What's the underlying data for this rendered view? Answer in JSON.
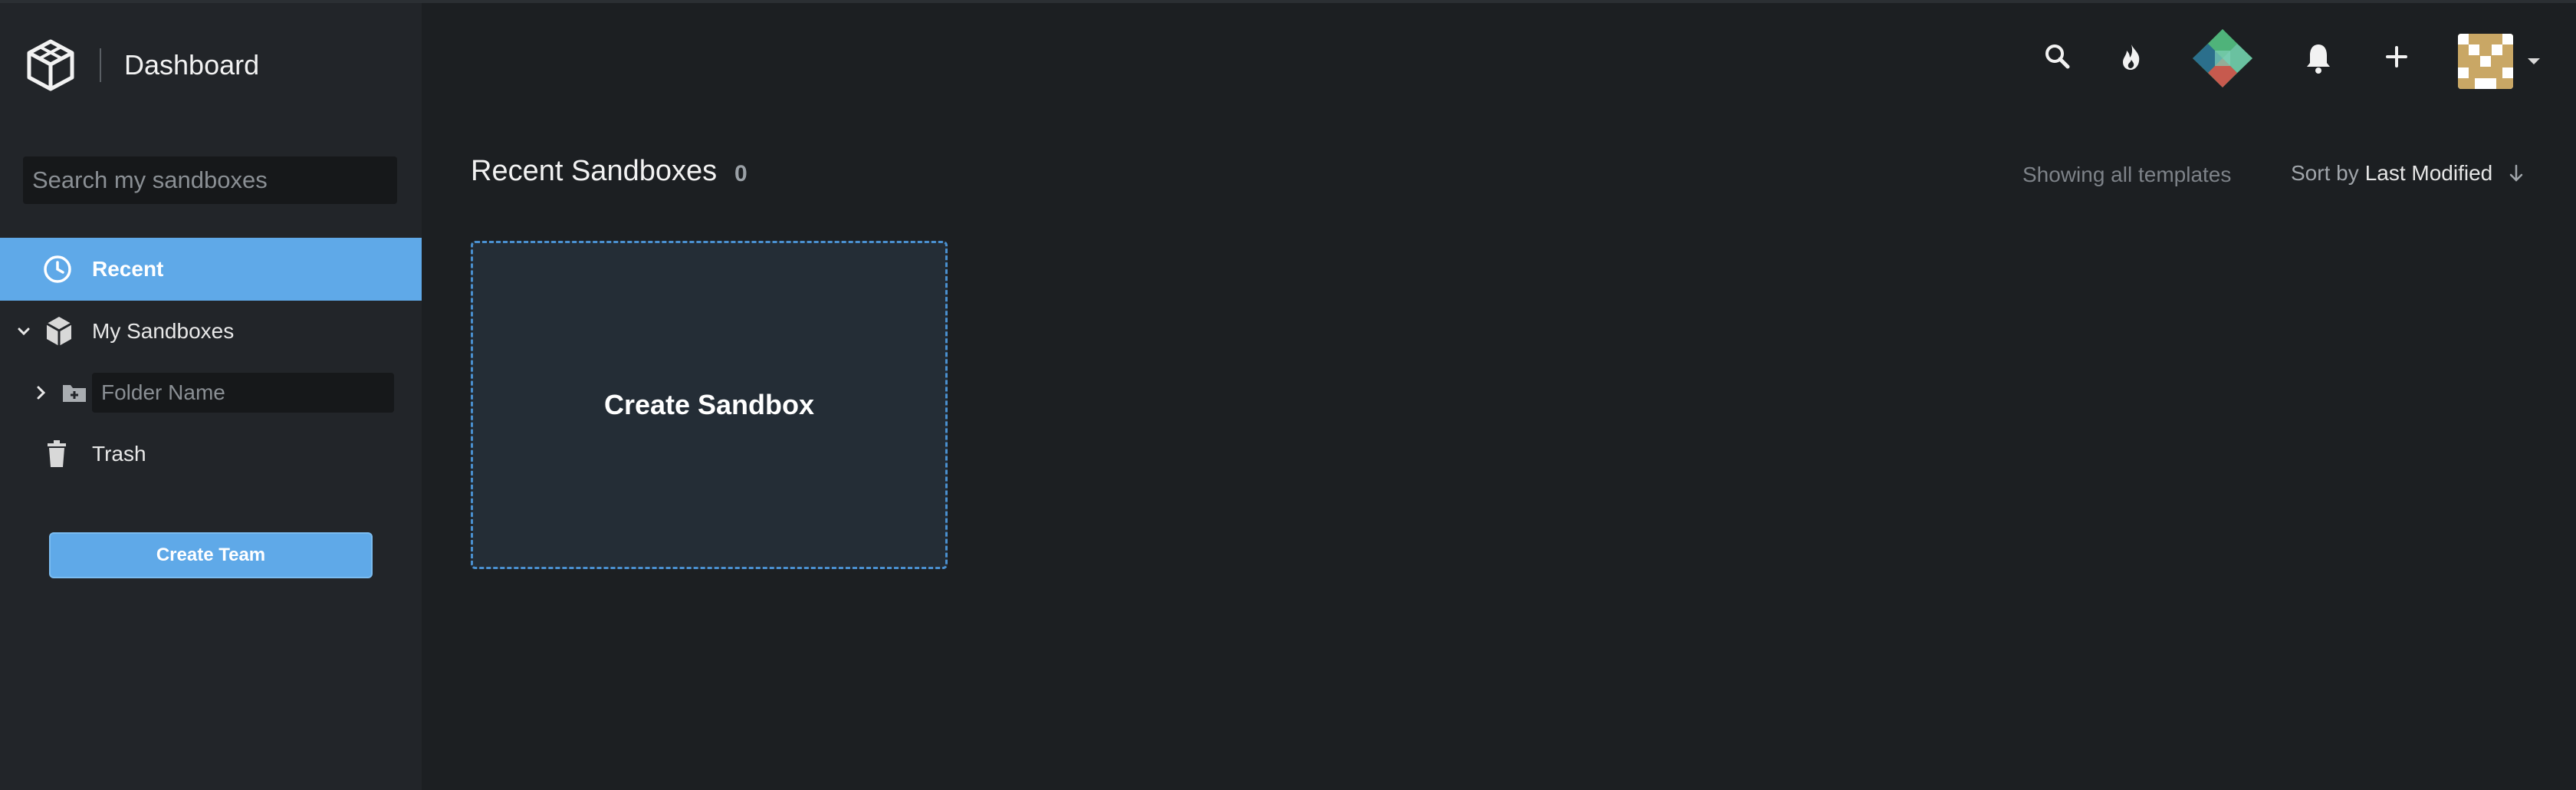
{
  "brand": {
    "title": "Dashboard"
  },
  "sidebar": {
    "search_placeholder": "Search my sandboxes",
    "items": [
      {
        "label": "Recent",
        "icon": "clock-icon",
        "active": true
      },
      {
        "label": "My Sandboxes",
        "icon": "box-icon"
      },
      {
        "label": "",
        "placeholder": "Folder Name",
        "icon": "folder-plus-icon"
      },
      {
        "label": "Trash",
        "icon": "trash-icon"
      }
    ],
    "create_team_label": "Create Team"
  },
  "topbar": {
    "icons": [
      "search-icon",
      "flame-icon",
      "gem-icon",
      "bell-icon",
      "plus-icon",
      "avatar",
      "caret-down-icon"
    ]
  },
  "main": {
    "title": "Recent Sandboxes",
    "count": "0",
    "showing_text": "Showing all templates",
    "sort_prefix": "Sort by",
    "sort_value": "Last Modified",
    "create_card_label": "Create Sandbox"
  },
  "colors": {
    "accent": "#5fa9e8",
    "sidebar_bg": "#222529",
    "main_bg": "#1c1f22",
    "card_bg": "#242d36",
    "card_border": "#4a90d0"
  }
}
